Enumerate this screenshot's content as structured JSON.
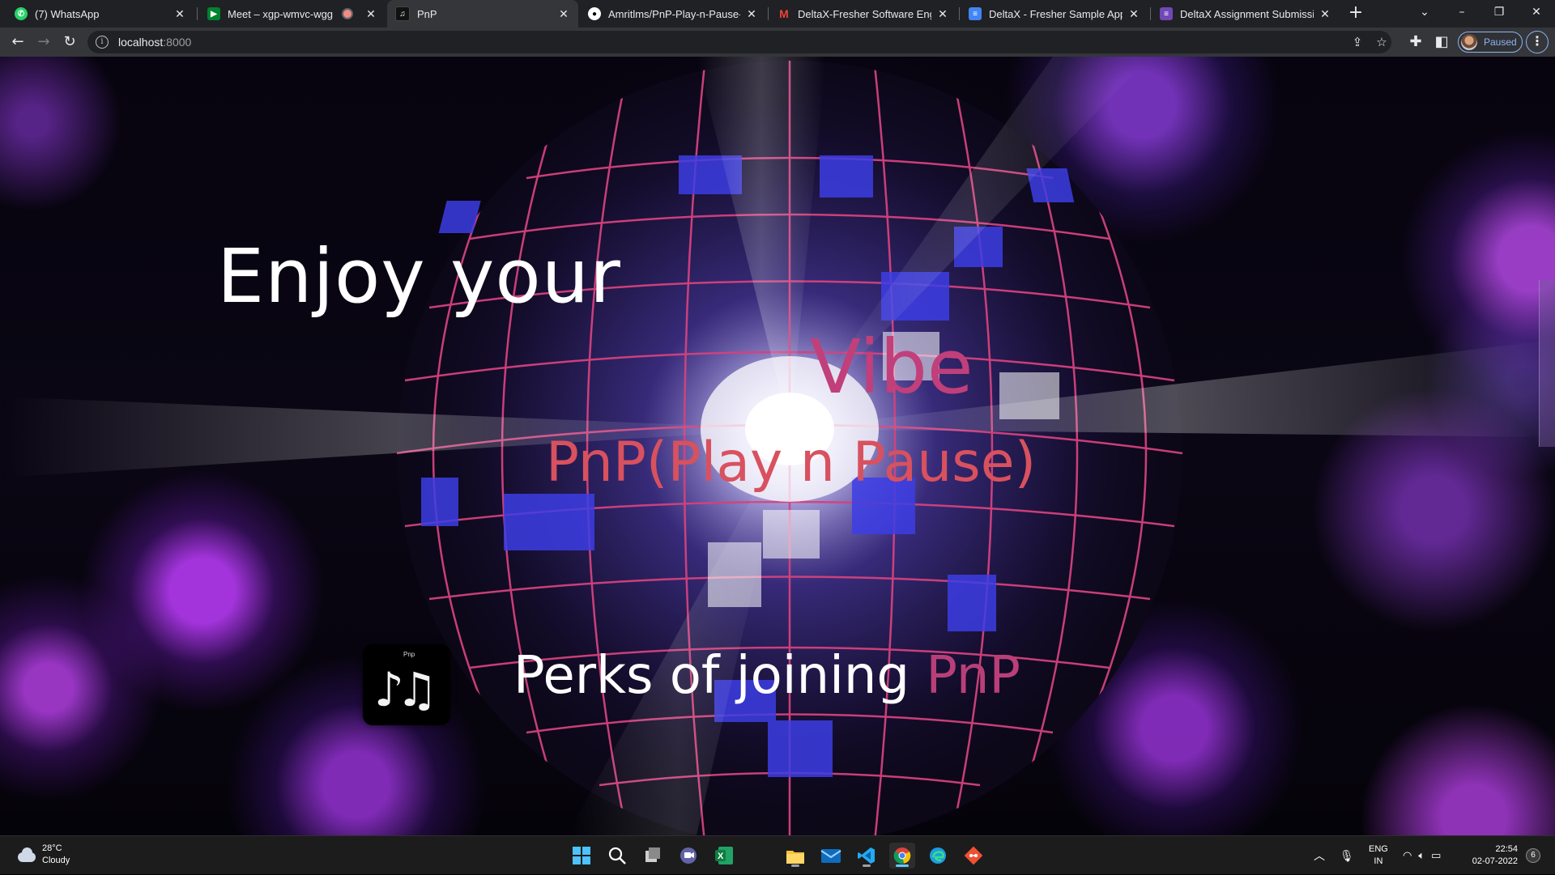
{
  "browser": {
    "tabs": [
      {
        "title": "(7) WhatsApp",
        "favicon": "whatsapp-icon",
        "active": false
      },
      {
        "title": "Meet – xgp-wmvc-wgg",
        "favicon": "google-meet-icon",
        "active": false,
        "recording": true
      },
      {
        "title": "PnP",
        "favicon": "pnp-icon",
        "active": true
      },
      {
        "title": "Amritlms/PnP-Play-n-Pause-: It c",
        "favicon": "github-icon",
        "active": false
      },
      {
        "title": "DeltaX-Fresher Software Engine",
        "favicon": "gmail-icon",
        "active": false
      },
      {
        "title": "DeltaX - Fresher Sample App - S",
        "favicon": "google-docs-icon",
        "active": false
      },
      {
        "title": "DeltaX Assignment Submission",
        "favicon": "google-forms-icon",
        "active": false
      }
    ],
    "new_tab": "+",
    "window_controls": {
      "tab_search": "⌄",
      "minimize": "–",
      "restore": "❐",
      "close": "✕"
    },
    "address": {
      "host": "localhost",
      "port": ":8000"
    },
    "profile": {
      "status": "Paused"
    },
    "accent": "#8ab4f8"
  },
  "page": {
    "hero_line1": "Enjoy your",
    "hero_vibe": "Vibe",
    "hero_pnp": "PnP(Play n Pause)",
    "perks_text": "Perks of joining ",
    "perks_accent": "PnP",
    "logo_caption": "Pnp",
    "colors": {
      "vibe": "#c13f7a",
      "pnp": "#d8515f",
      "accent": "#b93f78"
    }
  },
  "taskbar": {
    "weather": {
      "temp": "28°C",
      "condition": "Cloudy"
    },
    "apps": [
      "windows-start-icon",
      "search-icon",
      "task-view-icon",
      "teams-chat-icon",
      "excel-icon",
      "file-explorer-icon",
      "mail-icon",
      "vscode-icon",
      "chrome-icon",
      "edge-icon",
      "git-icon"
    ],
    "tray": {
      "language": "ENG",
      "region": "IN",
      "time": "22:54",
      "date": "02-07-2022",
      "notifications": "6"
    }
  }
}
